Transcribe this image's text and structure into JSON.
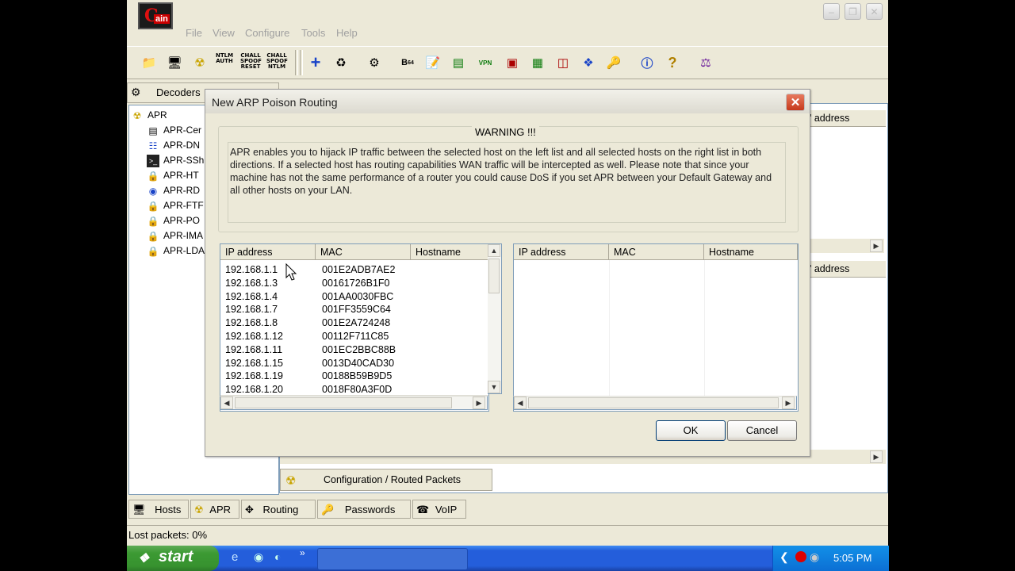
{
  "app": {
    "menu": [
      "File",
      "View",
      "Configure",
      "Tools",
      "Help"
    ],
    "decoders_tab": "Decoders",
    "tree": [
      {
        "label": "APR",
        "icon": "radiation-icon"
      },
      {
        "label": "APR-Cer",
        "icon": "cert-icon"
      },
      {
        "label": "APR-DN",
        "icon": "network-icon"
      },
      {
        "label": "APR-SSh",
        "icon": "terminal-icon"
      },
      {
        "label": "APR-HT",
        "icon": "lock-icon"
      },
      {
        "label": "APR-RD",
        "icon": "globe-icon"
      },
      {
        "label": "APR-FTF",
        "icon": "lock-icon"
      },
      {
        "label": "APR-PO",
        "icon": "lock-icon"
      },
      {
        "label": "APR-IMA",
        "icon": "lock-icon"
      },
      {
        "label": "APR-LDA",
        "icon": "lock-icon"
      }
    ],
    "right_header_1": "' address",
    "right_header_2": "' address",
    "config_tab": "Configuration / Routed Packets",
    "bottom_tabs": [
      "Hosts",
      "APR",
      "Routing",
      "Passwords",
      "VoIP"
    ],
    "status_text": "Lost packets:  0%"
  },
  "dialog": {
    "title": "New ARP Poison Routing",
    "warning_title": "WARNING !!!",
    "warning_text": "APR enables you to hijack IP traffic between the selected host on the left list and all selected hosts on the right list in both directions. If a selected host has routing capabilities WAN traffic will be intercepted as well. Please note that since your machine has not the same performance of a router you could cause DoS if you set APR between your Default Gateway and all other hosts on your LAN.",
    "columns": [
      "IP address",
      "MAC",
      "Hostname"
    ],
    "left_rows": [
      {
        "ip": "192.168.1.1",
        "mac": "001E2ADB7AE2"
      },
      {
        "ip": "192.168.1.3",
        "mac": "00161726B1F0"
      },
      {
        "ip": "192.168.1.4",
        "mac": "001AA0030FBC"
      },
      {
        "ip": "192.168.1.7",
        "mac": "001FF3559C64"
      },
      {
        "ip": "192.168.1.8",
        "mac": "001E2A724248"
      },
      {
        "ip": "192.168.1.12",
        "mac": "00112F711C85"
      },
      {
        "ip": "192.168.1.11",
        "mac": "001EC2BBC88B"
      },
      {
        "ip": "192.168.1.15",
        "mac": "0013D40CAD30"
      },
      {
        "ip": "192.168.1.19",
        "mac": "00188B59B9D5"
      },
      {
        "ip": "192.168.1.20",
        "mac": "0018F80A3F0D"
      }
    ],
    "ok": "OK",
    "cancel": "Cancel"
  },
  "taskbar": {
    "start": "start",
    "time": "5:05 PM"
  }
}
